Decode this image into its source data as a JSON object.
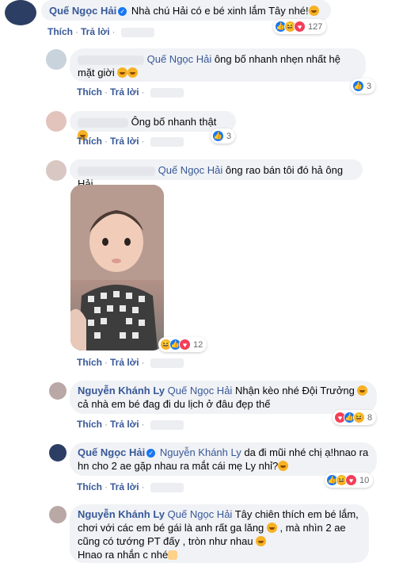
{
  "comments": [
    {
      "author": "Quế Ngọc Hải",
      "text": "Nhà chú Hải có e bé xinh lắm Tây nhé!",
      "reactions": "127",
      "like": "Thích",
      "reply": "Trả lời"
    },
    {
      "tag": "Quế Ngọc Hải",
      "text": "ông bố nhanh nhẹn nhất hệ mặt giời",
      "reactions": "3",
      "like": "Thích",
      "reply": "Trả lời"
    },
    {
      "text": "Ông bố nhanh thật",
      "reactions": "3",
      "like": "Thích",
      "reply": "Trả lời"
    },
    {
      "tag": "Quế Ngọc Hải",
      "text": "ông rao bán tôi đó hả ông Hải",
      "reactions": "12",
      "like": "Thích",
      "reply": "Trả lời"
    },
    {
      "author": "Nguyễn Khánh Ly",
      "tag": "Quế Ngọc Hải",
      "text_line1": "Nhận kèo nhé Đội Trưởng",
      "text_line2": "cả nhà em bé đag đi du lịch ở đâu đẹp thế",
      "reactions": "8",
      "like": "Thích",
      "reply": "Trả lời"
    },
    {
      "author": "Quế Ngọc Hải",
      "tag": "Nguyễn Khánh Ly",
      "text_line1": "da đi mũi nhé chị ạ!hnao ra",
      "text_line2": "hn cho 2 ae gặp nhau ra mắt cái mẹ Ly nhỉ?",
      "reactions": "10",
      "like": "Thích",
      "reply": "Trả lời"
    },
    {
      "author": "Nguyễn Khánh Ly",
      "tag": "Quế Ngọc Hải",
      "text_line1": "Tây chiên thích em bé lắm,",
      "text_line2": "chơi với các em bé gái là anh rất ga lăng",
      "text_line2b": ", mà nhìn 2 ae",
      "text_line3": "cũng có tướng PT đấy , tròn như nhau",
      "text_line4": "Hnao ra nhắn c nhé"
    }
  ]
}
